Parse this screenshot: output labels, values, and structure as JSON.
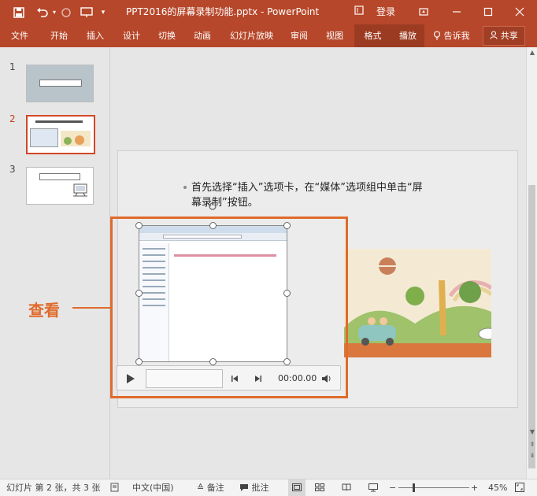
{
  "titlebar": {
    "title": "PPT2016的屏幕录制功能.pptx  -  PowerPoint",
    "login": "登录",
    "qat_save": "save-icon",
    "qat_undo": "undo-icon",
    "qat_redo": "redo-icon",
    "qat_slideshow": "slideshow-icon",
    "qat_more": "customize-icon"
  },
  "ribbon": {
    "tabs": [
      "文件",
      "开始",
      "插入",
      "设计",
      "切换",
      "动画",
      "幻灯片放映",
      "审阅",
      "视图",
      "格式",
      "播放"
    ],
    "tell_me": "告诉我",
    "share": "共享"
  },
  "thumbnails": [
    {
      "number": "1"
    },
    {
      "number": "2"
    },
    {
      "number": "3"
    }
  ],
  "slide": {
    "bullet_text": "首先选择“插入”选项卡，在“媒体”选项组中单击“屏幕录制”按钮。"
  },
  "media_bar": {
    "time": "00:00.00"
  },
  "callout": {
    "label": "查看"
  },
  "statusbar": {
    "slide_info": "幻灯片 第 2 张，共 3 张",
    "language": "中文(中国)",
    "notes": "备注",
    "comments": "批注",
    "zoom": "45%"
  },
  "colors": {
    "accent": "#b7472a",
    "callout": "#e06b2b",
    "active_thumb": "#d24726"
  }
}
